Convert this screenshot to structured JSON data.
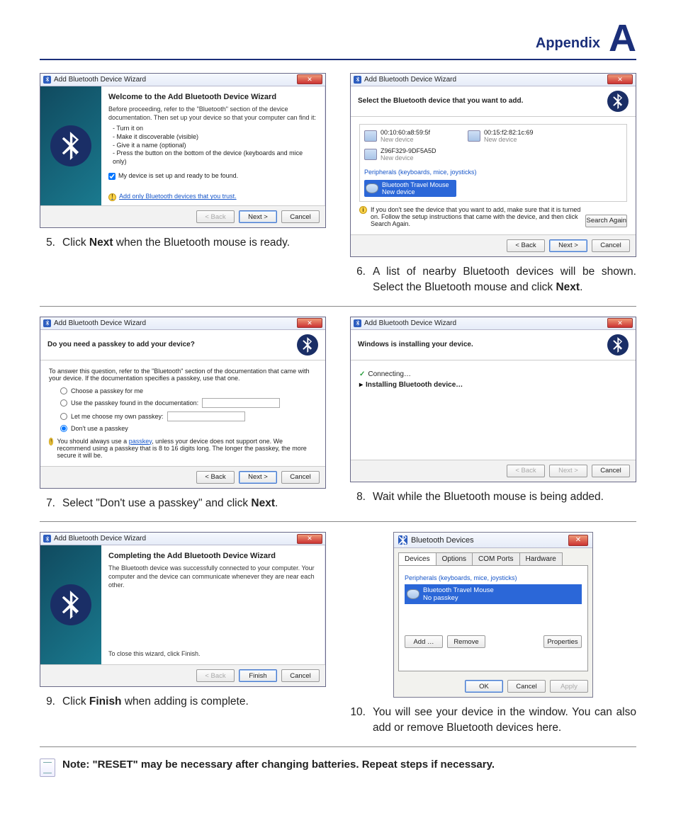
{
  "header": {
    "title": "Appendix",
    "letter": "A"
  },
  "wizard_title": "Add Bluetooth Device Wizard",
  "btn": {
    "back": "< Back",
    "next": "Next >",
    "cancel": "Cancel",
    "finish": "Finish",
    "search": "Search Again",
    "ok": "OK",
    "apply": "Apply",
    "add": "Add …",
    "remove": "Remove",
    "properties": "Properties"
  },
  "step5": {
    "heading": "Welcome to the Add Bluetooth Device Wizard",
    "intro": "Before proceeding, refer to the \"Bluetooth\" section of the device documentation. Then set up your device so that your computer can find it:",
    "bullets": [
      "Turn it on",
      "Make it discoverable (visible)",
      "Give it a name (optional)",
      "Press the button on the bottom of the device (keyboards and mice only)"
    ],
    "checkbox": "My device is set up and ready to be found.",
    "link": "Add only Bluetooth devices that you trust.",
    "caption_num": "5.",
    "caption_pre": "Click ",
    "caption_bold": "Next",
    "caption_post": " when the Bluetooth mouse is ready."
  },
  "step6": {
    "heading": "Select the Bluetooth device that you want to add.",
    "devices": [
      {
        "name": "00:10:60:a8:59:5f",
        "sub": "New device"
      },
      {
        "name": "00:15:f2:82:1c:69",
        "sub": "New device"
      },
      {
        "name": "Z96F329-9DF5A5D",
        "sub": "New device"
      }
    ],
    "category": "Peripherals (keyboards, mice, joysticks)",
    "selected": {
      "name": "Bluetooth Travel Mouse",
      "sub": "New device"
    },
    "info": "If you don't see the device that you want to add, make sure that it is turned on. Follow the setup instructions that came with the device, and then click Search Again.",
    "caption_num": "6.",
    "caption_a": "A list of nearby Bluetooth devices will be shown. Select the Bluetooth mouse and click ",
    "caption_bold": "Next",
    "caption_b": "."
  },
  "step7": {
    "heading": "Do you need a passkey to add your device?",
    "intro": "To answer this question, refer to the \"Bluetooth\" section of the documentation that came with your device. If the documentation specifies a passkey, use that one.",
    "opts": [
      "Choose a passkey for me",
      "Use the passkey found in the documentation:",
      "Let me choose my own passkey:",
      "Don't use a passkey"
    ],
    "warn_a": "You should always use a ",
    "warn_link": "passkey",
    "warn_b": ", unless your device does not support one. We recommend using a passkey that is 8 to 16 digits long. The longer the passkey, the more secure it will be.",
    "caption_num": "7.",
    "caption_a": "Select \"Don't use a passkey\" and click ",
    "caption_bold": "Next",
    "caption_b": "."
  },
  "step8": {
    "heading": "Windows is installing your device.",
    "line1": "Connecting…",
    "line2": "Installing Bluetooth device…",
    "caption_num": "8.",
    "caption": "Wait while the Bluetooth mouse is being added."
  },
  "step9": {
    "heading": "Completing the Add Bluetooth Device Wizard",
    "body": "The Bluetooth device was successfully connected to your computer. Your computer and the device can communicate whenever they are near each other.",
    "close": "To close this wizard, click Finish.",
    "caption_num": "9.",
    "caption_a": "Click ",
    "caption_bold": "Finish",
    "caption_b": " when adding is complete."
  },
  "step10": {
    "title": "Bluetooth Devices",
    "tabs": [
      "Devices",
      "Options",
      "COM Ports",
      "Hardware"
    ],
    "category": "Peripherals (keyboards, mice, joysticks)",
    "device": "Bluetooth Travel Mouse",
    "device_sub": "No passkey",
    "caption_num": "10.",
    "caption": "You will see your device in the window. You can also add or remove Bluetooth devices here."
  },
  "note": "Note: \"RESET\" may be necessary after changing batteries. Repeat steps if necessary."
}
